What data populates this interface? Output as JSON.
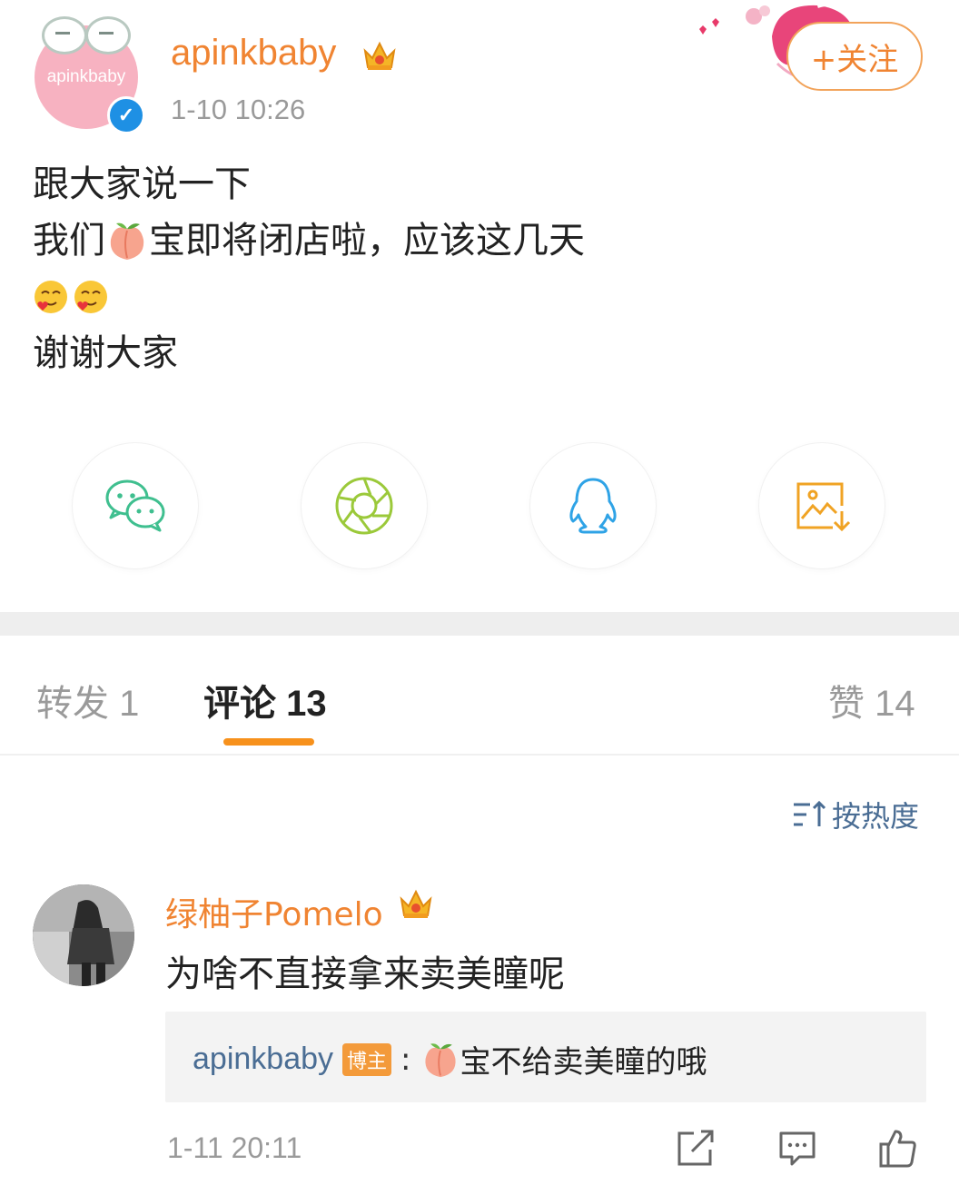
{
  "post": {
    "username": "apinkbaby",
    "avatar_text": "apinkbaby",
    "timestamp": "1-10 10:26",
    "follow_label": "+关注",
    "lines": {
      "l1": "跟大家说一下",
      "l2_a": "我们",
      "l2_b": "宝即将闭店啦，应该这几天",
      "l4": "谢谢大家"
    }
  },
  "share": {
    "items": [
      "wechat-icon",
      "moments-icon",
      "qq-icon",
      "save-image-icon"
    ]
  },
  "tabs": {
    "repost": "转发 1",
    "comments": "评论 13",
    "likes": "赞 14"
  },
  "sort_label": "按热度",
  "comment": {
    "username": "绿柚子Pomelo",
    "text": "为啥不直接拿来卖美瞳呢",
    "time": "1-11 20:11",
    "reply": {
      "username": "apinkbaby",
      "tag": "博主",
      "colon": ":",
      "text": "宝不给卖美瞳的哦"
    }
  },
  "colors": {
    "accent_orange": "#f08432",
    "link_blue": "#4a6d94",
    "verify_blue": "#1e90e4"
  }
}
